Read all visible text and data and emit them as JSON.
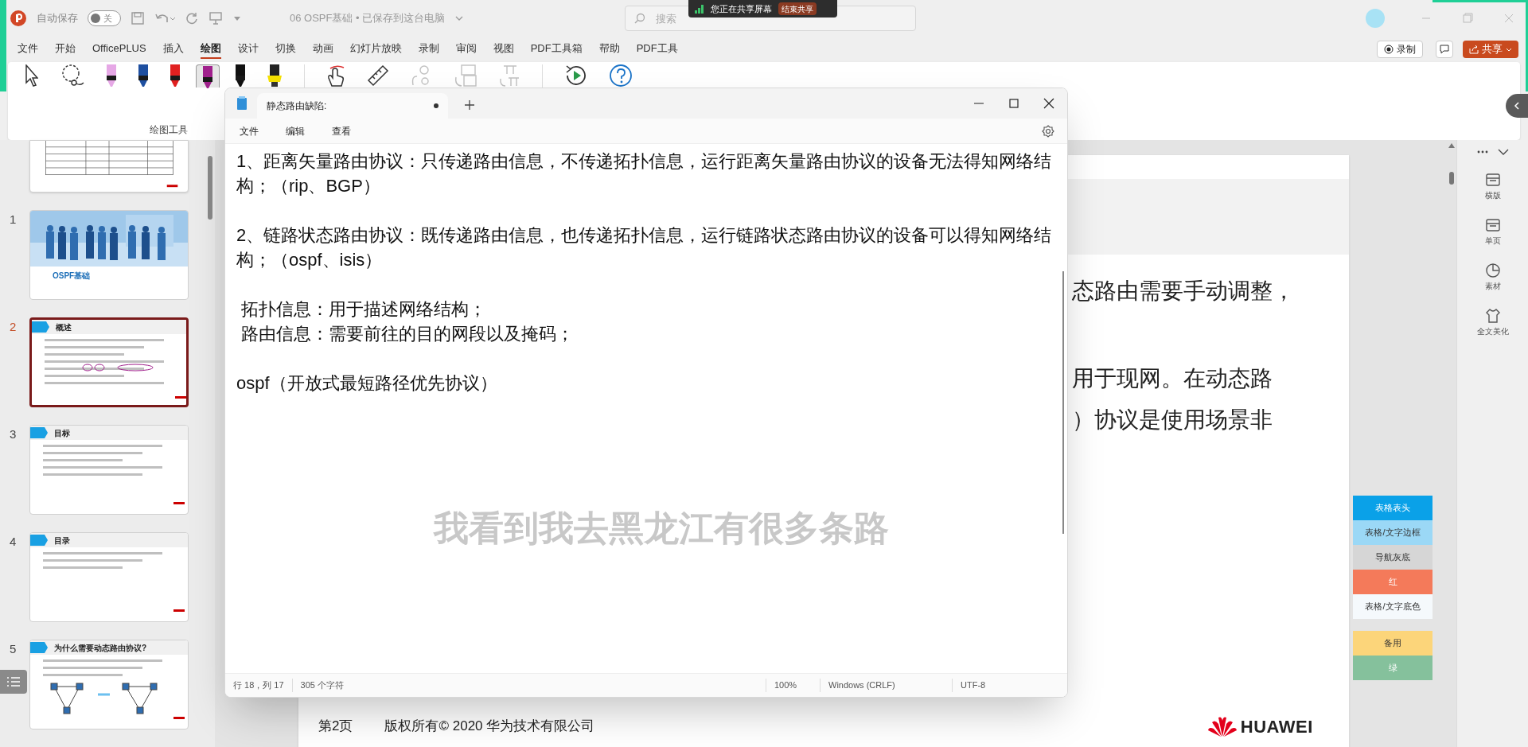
{
  "titlebar": {
    "autosave_label": "自动保存",
    "autosave": {
      "on": false,
      "label": "关"
    },
    "document_title": "06 OSPF基础 • 已保存到这台电脑",
    "search": {
      "placeholder": "搜索"
    },
    "share_banner": {
      "text": "您正在共享屏幕",
      "button": "结束共享"
    }
  },
  "menu": [
    {
      "label": "文件",
      "selected": false
    },
    {
      "label": "开始",
      "selected": false
    },
    {
      "label": "OfficePLUS",
      "selected": false
    },
    {
      "label": "插入",
      "selected": false
    },
    {
      "label": "绘图",
      "selected": true
    },
    {
      "label": "设计",
      "selected": false
    },
    {
      "label": "切换",
      "selected": false
    },
    {
      "label": "动画",
      "selected": false
    },
    {
      "label": "幻灯片放映",
      "selected": false
    },
    {
      "label": "录制",
      "selected": false
    },
    {
      "label": "审阅",
      "selected": false
    },
    {
      "label": "视图",
      "selected": false
    },
    {
      "label": "PDF工具箱",
      "selected": false
    },
    {
      "label": "帮助",
      "selected": false
    },
    {
      "label": "PDF工具",
      "selected": false
    }
  ],
  "actions": {
    "record": "录制",
    "share": "共享"
  },
  "ribbon": {
    "group_label": "绘图工具",
    "tools": [
      {
        "kind": "pointer",
        "selected": false,
        "disabled": false
      },
      {
        "kind": "lasso",
        "selected": false,
        "disabled": false
      },
      {
        "kind": "pen",
        "color": "#e6a8e6",
        "selected": false,
        "disabled": false
      },
      {
        "kind": "pen",
        "color": "#1e4fa0",
        "selected": false,
        "disabled": false
      },
      {
        "kind": "pen",
        "color": "#e02020",
        "selected": false,
        "disabled": false
      },
      {
        "kind": "pen",
        "color": "#a0208c",
        "selected": true,
        "disabled": false
      },
      {
        "kind": "pen",
        "color": "#111111",
        "selected": false,
        "disabled": false
      },
      {
        "kind": "highlighter",
        "color": "#f5e000",
        "selected": false,
        "disabled": false
      },
      {
        "kind": "touch",
        "selected": false,
        "disabled": false
      },
      {
        "kind": "ruler",
        "selected": false,
        "disabled": false
      },
      {
        "kind": "ink_to_text",
        "selected": false,
        "disabled": true
      },
      {
        "kind": "ink_to_shape",
        "selected": false,
        "disabled": true
      },
      {
        "kind": "ink_to_math",
        "selected": false,
        "disabled": true
      },
      {
        "kind": "replay",
        "selected": false,
        "disabled": false
      },
      {
        "kind": "help",
        "selected": false,
        "disabled": false
      }
    ]
  },
  "thumbnails": [
    {
      "kind": "table",
      "selected": false
    },
    {
      "number": "1",
      "title": "OSPF基础",
      "kind": "cover",
      "selected": false
    },
    {
      "number": "2",
      "title": "概述",
      "kind": "text",
      "selected": true
    },
    {
      "number": "3",
      "title": "目标",
      "kind": "text",
      "selected": false
    },
    {
      "number": "4",
      "title": "目录",
      "kind": "toc",
      "selected": false
    },
    {
      "number": "5",
      "title": "为什么需要动态路由协议?",
      "kind": "diagram",
      "selected": false
    }
  ],
  "slide": {
    "lines": [
      "态路由需要手动调整，",
      "用于现网。在动态路",
      "）协议是使用场景非"
    ],
    "page": "第2页",
    "copyright": "版权所有© 2020 华为技术有限公司",
    "logo_text": "HUAWEI"
  },
  "palette": [
    {
      "label": "表格表头",
      "color": "#0aa1e8"
    },
    {
      "label": "表格/文字边框",
      "color": "#9bd8f6"
    },
    {
      "label": "导航灰底",
      "color": "#d6d6d6"
    },
    {
      "label": "红",
      "color": "#f47a5a"
    },
    {
      "label": "表格/文字底色",
      "color": "#f5f9fc"
    },
    {
      "label": "备用",
      "color": "#fcd57a"
    },
    {
      "label": "绿",
      "color": "#85c19c"
    }
  ],
  "side_panel": {
    "items": [
      "横版",
      "单页",
      "素材",
      "全文美化"
    ]
  },
  "notepad": {
    "tab_title": "静态路由缺陷:",
    "modified": true,
    "menu": [
      "文件",
      "编辑",
      "查看"
    ],
    "paragraphs": [
      [
        "1、距离矢量路由协议：只传递路由信息，不传递拓扑信息，运行距离矢量路由协议的设备无法得知网络结构；（rip、BGP）"
      ],
      [
        "2、链路状态路由协议：既传递路由信息，也传递拓扑信息，运行链路状态路由协议的设备可以得知网络结构；（ospf、isis）"
      ],
      [
        " 拓扑信息：用于描述网络结构；",
        " 路由信息：需要前往的目的网段以及掩码；"
      ],
      [
        "ospf（开放式最短路径优先协议）"
      ]
    ],
    "status": {
      "position": "行 18，列 17",
      "chars": "305 个字符",
      "zoom": "100%",
      "line_ending": "Windows (CRLF)",
      "encoding": "UTF-8"
    }
  },
  "subtitle": "我看到我去黑龙江有很多条路"
}
